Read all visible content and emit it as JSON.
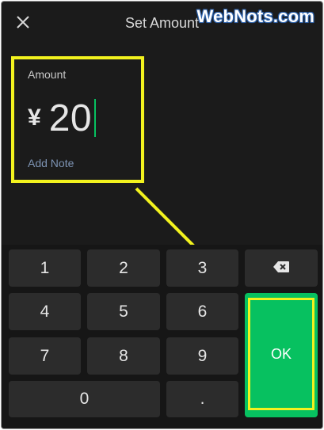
{
  "header": {
    "title": "Set Amount",
    "close_icon": "close-icon"
  },
  "watermark": "WebNots.com",
  "amount": {
    "label": "Amount",
    "currency": "¥",
    "value": "20",
    "add_note": "Add Note"
  },
  "keypad": {
    "keys": [
      "1",
      "2",
      "3",
      "4",
      "5",
      "6",
      "7",
      "8",
      "9",
      "0",
      "."
    ],
    "backspace_icon": "backspace-icon",
    "ok_label": "OK"
  },
  "colors": {
    "background": "#1b1b1b",
    "accent_green": "#07c160",
    "highlight_yellow": "#f2f21e",
    "key_bg": "#2c2c2c"
  }
}
